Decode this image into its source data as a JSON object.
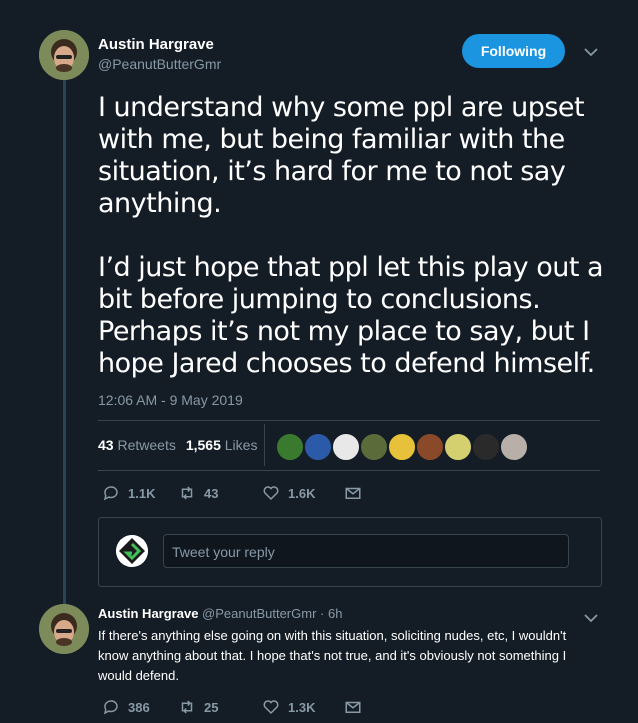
{
  "tweet": {
    "author_name": "Austin Hargrave",
    "author_handle": "@PeanutButterGmr",
    "follow_label": "Following",
    "text": "I understand why some ppl are upset with me, but being familiar with the situation, it’s hard for me to not say anything.\n\nI’d just hope that ppl let this play out a bit before jumping to conclusions. Perhaps it’s not my place to say, but I hope Jared chooses to defend himself.",
    "timestamp": "12:06 AM - 9 May 2019",
    "retweets_count": "43",
    "retweets_label": "Retweets",
    "likes_count": "1,565",
    "likes_label": "Likes",
    "replies": "1.1K",
    "retweets": "43",
    "likes": "1.6K"
  },
  "liker_colors": [
    "#3a7a2f",
    "#2b5aa8",
    "#e8e8e8",
    "#5b6b3a",
    "#e8c13a",
    "#8a4a2a",
    "#d4d070",
    "#2a2a2a",
    "#b8b0a8"
  ],
  "reply_box": {
    "placeholder": "Tweet your reply"
  },
  "reply": {
    "author_name": "Austin Hargrave",
    "author_handle": "@PeanutButterGmr",
    "age": "· 6h",
    "text": "If there's anything else going on with this situation, soliciting nudes, etc, I wouldn't know anything about that. I hope that's not true, and it's obviously not something I would defend.",
    "replies": "386",
    "retweets": "25",
    "likes": "1.3K"
  },
  "colors": {
    "accent": "#1b95e0",
    "background": "#141d26",
    "muted": "#8899a6"
  }
}
